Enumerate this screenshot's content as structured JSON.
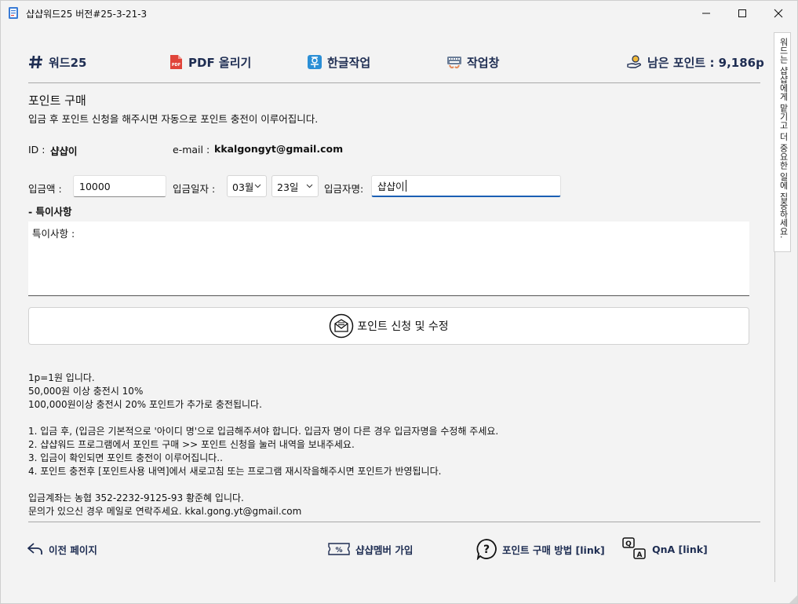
{
  "window": {
    "title": "샵샵워드25  버전#25-3-21-3",
    "minimize_glyph": "—",
    "maximize_glyph": "☐",
    "close_glyph": "✕"
  },
  "toolbar": {
    "items": [
      {
        "label": "워드25",
        "icon": "hash-icon"
      },
      {
        "label": "PDF 올리기",
        "icon": "pdf-icon"
      },
      {
        "label": "한글작업",
        "icon": "hangul-icon"
      },
      {
        "label": "작업창",
        "icon": "keyboard-icon"
      }
    ],
    "points_label": "남은 포인트 : 9,186p"
  },
  "side_panel": {
    "text": "워드는 샵샵에게 맡기고 더 중요한 일에 집중하세요."
  },
  "purchase": {
    "title": "포인트 구매",
    "description": "입금 후 포인트 신청을 해주시면 자동으로 포인트 충전이 이루어집니다.",
    "id_label": "ID :",
    "id_value": "샵샵이",
    "email_label": "e-mail :",
    "email_value": "kkalgongyt@gmail.com",
    "amount_label": "입금액 :",
    "amount_value": "10000",
    "date_label": "입금일자 :",
    "month_value": "03월",
    "day_value": "23일",
    "depositor_label": "입금자명:",
    "depositor_value": "샵샵이",
    "notes_label": "- 특이사항",
    "notes_value": "특이사항 :",
    "submit_label": "포인트 신청 및 수정"
  },
  "info_lines": [
    "1p=1원 입니다.",
    "50,000원 이상 충전시 10%",
    "100,000원이상 충전시 20% 포인트가 추가로 충전됩니다.",
    "",
    "1. 입금 후, (입금은 기본적으로 '아이디 명'으로 입금해주셔야 합니다. 입금자 명이 다른 경우 입금자명을 수정해 주세요.",
    "2. 샵샵워드 프로그램에서 포인트 구매 >> 포인트 신청을 눌러 내역을 보내주세요.",
    "3. 입금이 확인되면 포인트 충전이 이루어집니다..",
    "4. 포인트 충전후 [포인트사용 내역]에서 새로고침 또는 프로그램 재시작을해주시면 포인트가 반영됩니다.",
    "",
    "입금계좌는 농협 352-2232-9125-93 황준혜 입니다.",
    "문의가 있으신 경우 메일로 연락주세요. kkal.gong.yt@gmail.com"
  ],
  "footer": {
    "back_label": "이전 페이지",
    "member_label": "샵샵멤버 가입",
    "howto_label": "포인트 구매 방법 [link]",
    "qna_label": "QnA [link]"
  },
  "colors": {
    "accent_navy": "#1e2d52",
    "pdf_red": "#e0443a",
    "hangul_blue": "#2b8fd6",
    "focus_blue": "#1a5fb4"
  }
}
